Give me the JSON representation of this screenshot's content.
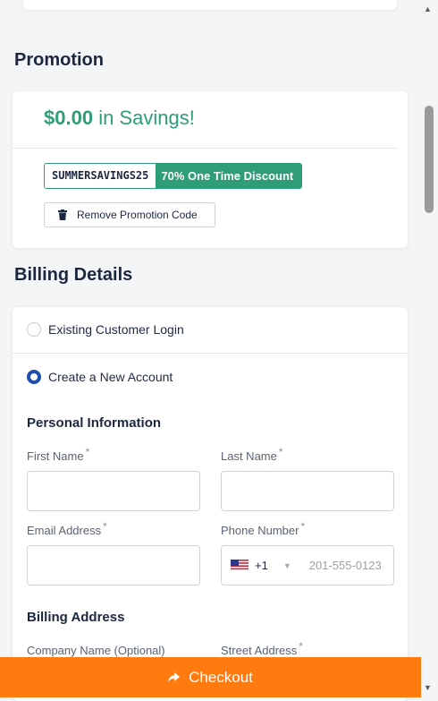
{
  "promotion": {
    "title": "Promotion",
    "savings_amount": "$0.00",
    "savings_text": "in Savings!",
    "promo_code": "SUMMERSAVINGS25",
    "discount_label": "70% One Time Discount",
    "remove_label": "Remove Promotion Code"
  },
  "billing": {
    "title": "Billing Details",
    "existing_login": "Existing Customer Login",
    "new_account": "Create a New Account",
    "personal_info": "Personal Information",
    "first_name": "First Name",
    "last_name": "Last Name",
    "email": "Email Address",
    "phone": "Phone Number",
    "required_mark": "*",
    "dial_code": "+1",
    "phone_placeholder": "201-555-0123",
    "billing_address": "Billing Address",
    "company": "Company Name (Optional)",
    "street": "Street Address"
  },
  "checkout": {
    "label": "Checkout"
  },
  "colors": {
    "accent": "#2f9e78",
    "checkout": "#ff7a0f",
    "radio_selected": "#1e4fb0"
  }
}
